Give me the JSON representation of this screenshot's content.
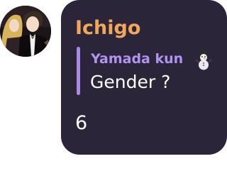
{
  "message": {
    "sender": "Ichigo",
    "reply": {
      "author": "Yamada kun",
      "author_icon": "snowman-icon",
      "text": "Gender ?"
    },
    "text": "6"
  },
  "colors": {
    "bubble": "#2b2539",
    "sender": "#f2a65c",
    "reply_author": "#b393f2",
    "reply_bar": "#a98ae6",
    "text": "#ffffff"
  }
}
